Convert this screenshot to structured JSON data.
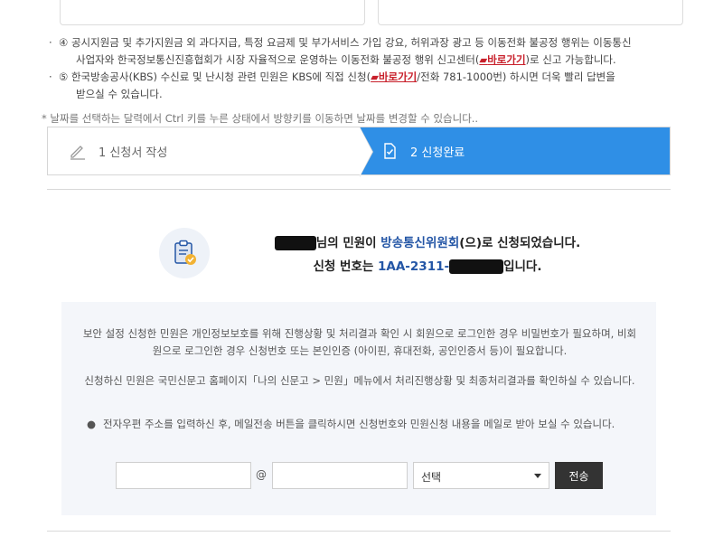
{
  "notices": [
    {
      "bullet": "·",
      "line1": "④ 공시지원금 및 추가지원금 외 과다지급, 특정 요금제 및 부가서비스 가입 강요, 허위과장 광고 등 이동전화 불공정 행위는 이동통신",
      "line2_before": "사업자와 한국정보통신진흥협회가 시장 자율적으로 운영하는 이동전화 불공정 행위 신고센터(",
      "link": "바로가기",
      "line2_after": ")로 신고 가능합니다."
    },
    {
      "bullet": "·",
      "line1_before": "⑤ 한국방송공사(KBS) 수신료 및 난시청 관련 민원은 KBS에 직접 신청(",
      "link": "바로가기",
      "line1_after": "/전화 781-1000번) 하시면 더욱 빨리 답변을",
      "line2": "받으실 수 있습니다."
    }
  ],
  "hint": "* 날짜를 선택하는 달력에서 Ctrl 키를 누른 상태에서 방향키를 이동하면 날짜를 변경할 수 있습니다..",
  "steps": [
    {
      "label": "1 신청서 작성",
      "icon": "pencil-icon",
      "active": false
    },
    {
      "label": "2 신청완료",
      "icon": "document-check-icon",
      "active": true
    }
  ],
  "result": {
    "line1_suffix": "님의 민원이 ",
    "org": "방송통신위원회",
    "line1_end": "(으)로 신청되었습니다.",
    "line2_prefix": "신청 번호는 ",
    "number": "1AA-2311-",
    "line2_end": "입니다."
  },
  "info": {
    "p1": "보안 설정 신청한 민원은 개인정보보호를 위해 진행상황 및 처리결과 확인 시 회원으로 로그인한 경우 비밀번호가 필요하며, 비회원으로 로그인한 경우 신청번호 또는 본인인증 (아이핀, 휴대전화, 공인인증서 등)이 필요합니다.",
    "p2": "신청하신 민원은 국민신문고 홈페이지「나의 신문고 > 민원」메뉴에서 처리진행상황 및 최종처리결과를 확인하실 수 있습니다.",
    "p3": "전자우편 주소를 입력하신 후, 메일전송 버튼을 클릭하시면 신청번호와 민원신청 내용을 메일로 받아 보실 수 있습니다."
  },
  "mail_form": {
    "at": "@",
    "select_value": "선택",
    "send_label": "전송"
  },
  "colors": {
    "accent": "#2f8fe6",
    "link": "#c8202b",
    "org": "#2456a6"
  }
}
